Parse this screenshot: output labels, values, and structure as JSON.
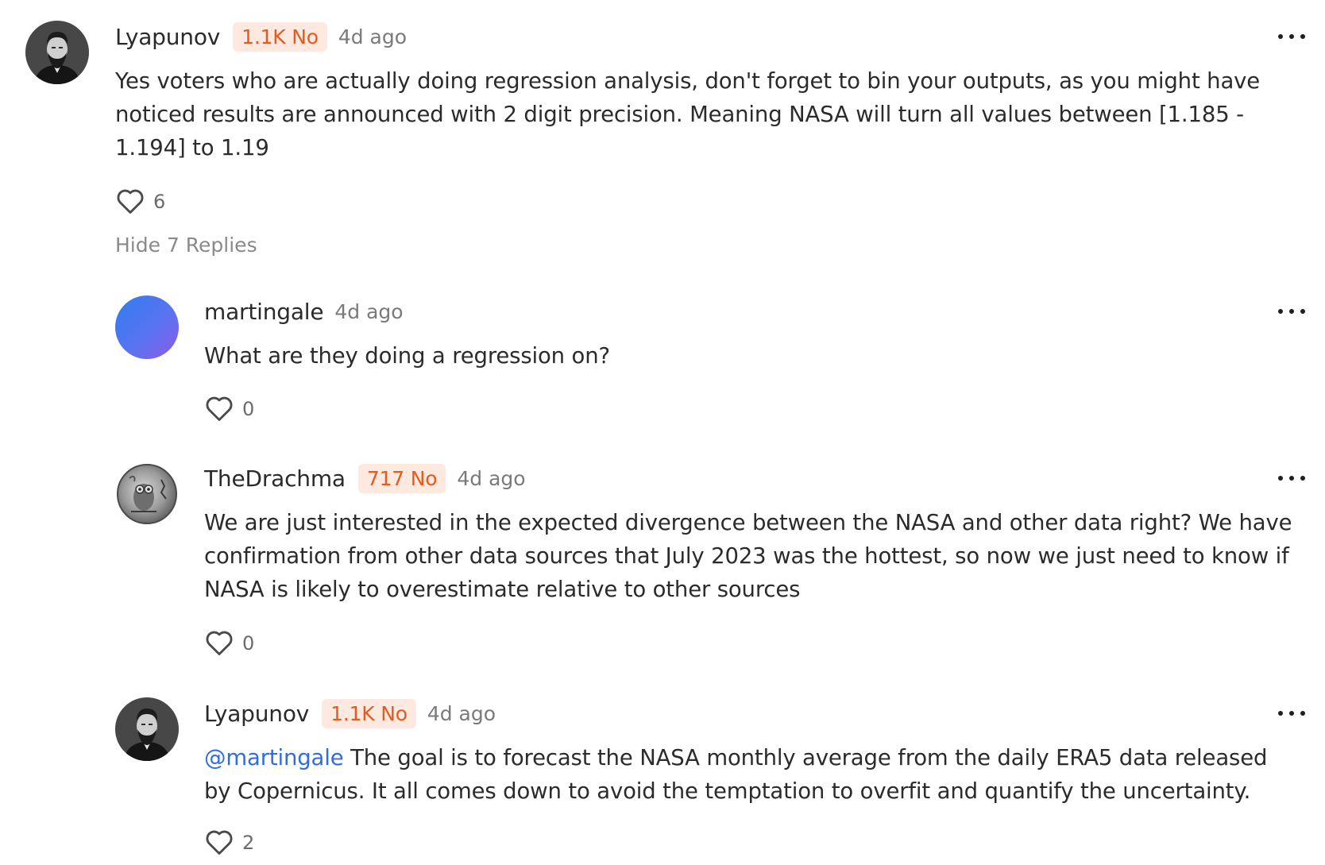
{
  "comments": [
    {
      "username": "Lyapunov",
      "badge": "1.1K No",
      "time": "4d ago",
      "text": "Yes voters who are actually doing regression analysis, don't forget to bin your outputs, as you might have noticed results are announced with 2 digit precision. Meaning NASA will turn all values between [1.185 - 1.194] to 1.19",
      "likes": "6",
      "avatar": "bearded-man-portrait"
    }
  ],
  "toggle_replies_label": "Hide 7 Replies",
  "replies": [
    {
      "username": "martingale",
      "time": "4d ago",
      "text": "What are they doing a regression on?",
      "likes": "0",
      "avatar": "gradient-circle"
    },
    {
      "username": "TheDrachma",
      "badge": "717 No",
      "time": "4d ago",
      "text": "We are just interested in the expected divergence between the NASA and other data right? We have confirmation from other data sources that July 2023 was the hottest, so now we just need to know if NASA is likely to overestimate relative to other sources",
      "likes": "0",
      "avatar": "owl-coin"
    },
    {
      "username": "Lyapunov",
      "badge": "1.1K No",
      "time": "4d ago",
      "mention": "@martingale",
      "text": " The goal is to forecast the NASA monthly average from the daily ERA5 data released by Copernicus. It all comes down to avoid the temptation to overfit and quantify the uncertainty.",
      "likes": "2",
      "avatar": "bearded-man-portrait"
    }
  ],
  "colors": {
    "badge_bg": "#fde9df",
    "badge_text": "#e8591c",
    "mention": "#2f6de0",
    "muted": "#7a7a7a"
  }
}
